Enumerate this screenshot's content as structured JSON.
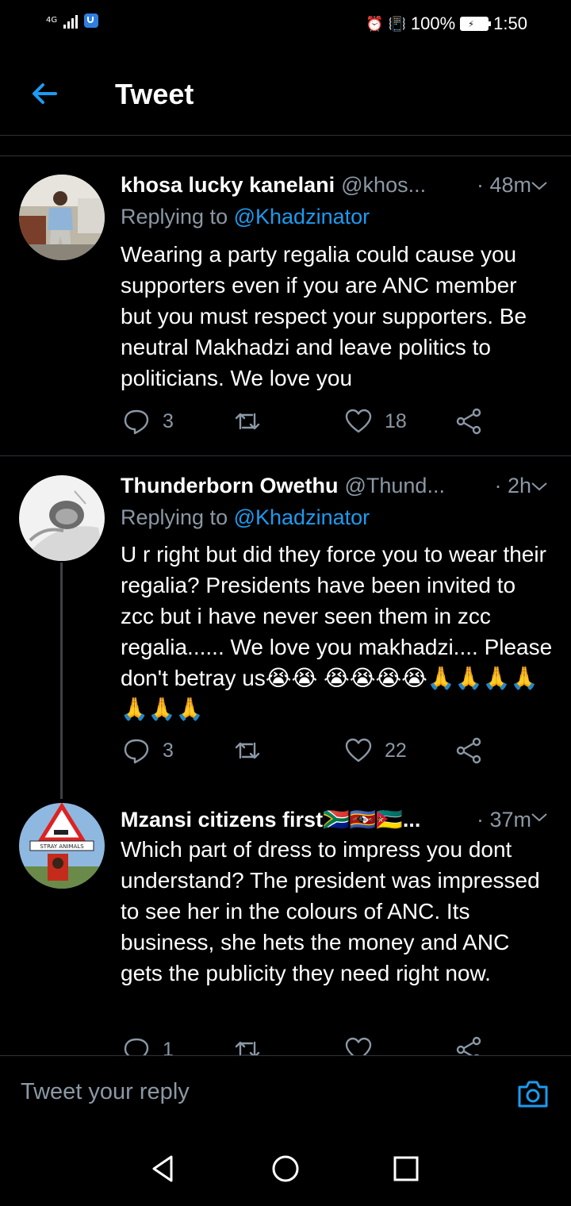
{
  "status_bar": {
    "network": "4G",
    "battery": "100%",
    "time": "1:50"
  },
  "header": {
    "title": "Tweet"
  },
  "tweets": [
    {
      "name": "khosa lucky kanelani",
      "handle": "@khos...",
      "time": "· 48m",
      "replying_label": "Replying to",
      "replying_to": "@Khadzinator",
      "text": "Wearing a party regalia could cause you supporters even if you are ANC member but you must respect your supporters. Be neutral Makhadzi and leave politics to politicians. We love you",
      "replies": "3",
      "retweets": "",
      "likes": "18"
    },
    {
      "name": "Thunderborn Owethu",
      "handle": "@Thund...",
      "time": "· 2h",
      "replying_label": "Replying to",
      "replying_to": "@Khadzinator",
      "text": "U r right but did they force you to wear their regalia? Presidents have been invited to zcc but i have never seen them in zcc regalia...... We love you makhadzi.... Please don't betray us😭😭 😭😭😭😭🙏🙏🙏🙏🙏🙏🙏",
      "replies": "3",
      "retweets": "",
      "likes": "22"
    },
    {
      "name": "Mzansi citizens first🇿🇦🇸🇿🇲🇿...",
      "handle": "",
      "time": "· 37m",
      "text": "Which part of dress to impress you dont understand? The president was impressed to see her in the colours of ANC. Its business, she hets the money and ANC gets the publicity they need right now.",
      "replies": "1",
      "retweets": "",
      "likes": ""
    }
  ],
  "avatar_signs": {
    "stray": "STRAY ANIMALS"
  },
  "reply_bar": {
    "placeholder": "Tweet your reply"
  },
  "colors": {
    "accent": "#1d9bf0",
    "muted": "#8b98a5",
    "divider": "#2f3336",
    "background": "#000000"
  },
  "icons": [
    "back-arrow-icon",
    "chevron-down-icon",
    "reply-icon",
    "retweet-icon",
    "like-icon",
    "share-icon",
    "camera-icon",
    "nav-back-icon",
    "nav-home-icon",
    "nav-recents-icon"
  ]
}
